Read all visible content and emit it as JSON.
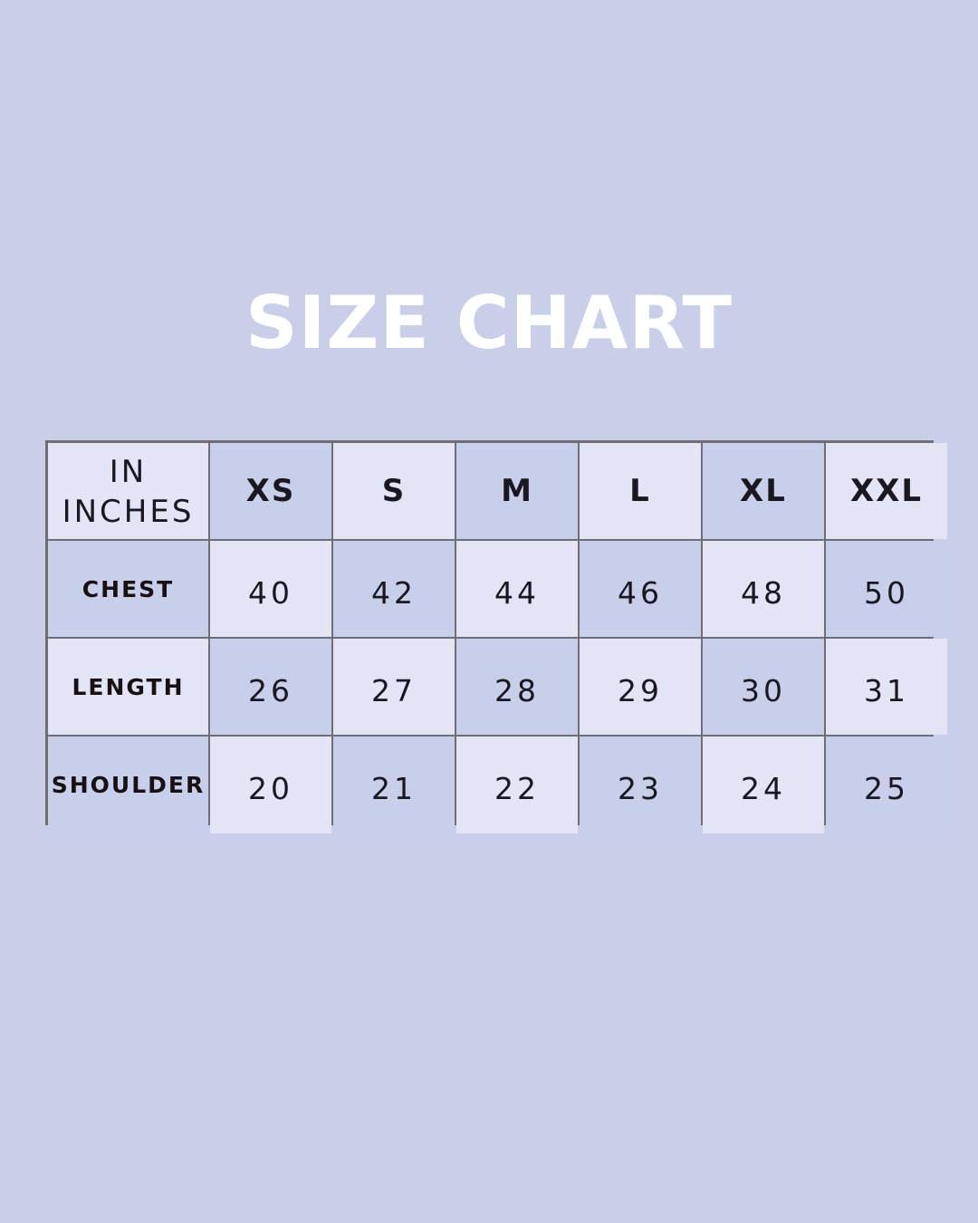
{
  "title": "SIZE CHART",
  "table": {
    "corner_line1": "IN",
    "corner_line2": "INCHES",
    "sizes": [
      "XS",
      "S",
      "M",
      "L",
      "XL",
      "XXL"
    ],
    "rows": [
      {
        "label": "CHEST",
        "values": [
          "40",
          "42",
          "44",
          "46",
          "48",
          "50"
        ]
      },
      {
        "label": "LENGTH",
        "values": [
          "26",
          "27",
          "28",
          "29",
          "30",
          "31"
        ]
      },
      {
        "label": "SHOULDER",
        "values": [
          "20",
          "21",
          "22",
          "23",
          "24",
          "25"
        ]
      }
    ]
  },
  "colors": {
    "background": "#c9cfe9",
    "cell_light": "#e3e5f7",
    "cell_dark": "#c8cfea",
    "grid_border": "#6e6e74",
    "title": "#ffffff",
    "text": "#1b1720"
  }
}
